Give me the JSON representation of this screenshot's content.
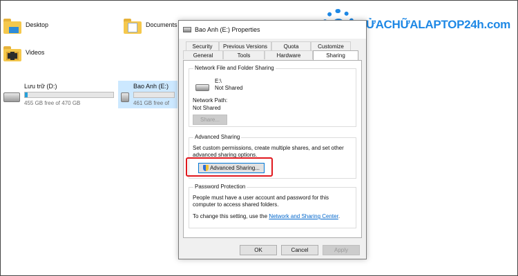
{
  "explorer": {
    "folders": [
      {
        "label": "Desktop"
      },
      {
        "label": "Documents"
      },
      {
        "label": "Videos"
      }
    ],
    "drives": [
      {
        "name": "Lưu trữ (D:)",
        "free": "455 GB free of 470 GB",
        "used_fraction": 0.03
      },
      {
        "name": "Bao Anh (E:)",
        "free": "461 GB free of"
      }
    ]
  },
  "logo": {
    "text": "SỬACHỮALAPTOP24h.com"
  },
  "dialog": {
    "title": "Bao Anh (E:) Properties",
    "tabs_row1": [
      "Security",
      "Previous Versions",
      "Quota",
      "Customize"
    ],
    "tabs_row2": [
      "General",
      "Tools",
      "Hardware",
      "Sharing"
    ],
    "active_tab": "Sharing",
    "network_sharing": {
      "group_title": "Network File and Folder Sharing",
      "path": "E:\\",
      "status": "Not Shared",
      "network_path_label": "Network Path:",
      "network_path_value": "Not Shared",
      "share_button": "Share..."
    },
    "advanced_sharing": {
      "group_title": "Advanced Sharing",
      "description": "Set custom permissions, create multiple shares, and set other advanced sharing options.",
      "button": "Advanced Sharing..."
    },
    "password_protection": {
      "group_title": "Password Protection",
      "description": "People must have a user account and password for this computer to access shared folders.",
      "change_text": "To change this setting, use the",
      "link": "Network and Sharing Center",
      "period": "."
    },
    "buttons": {
      "ok": "OK",
      "cancel": "Cancel",
      "apply": "Apply"
    }
  },
  "colors": {
    "accent": "#1e88e5",
    "highlight": "#e0171d",
    "progress": "#26a0da"
  }
}
